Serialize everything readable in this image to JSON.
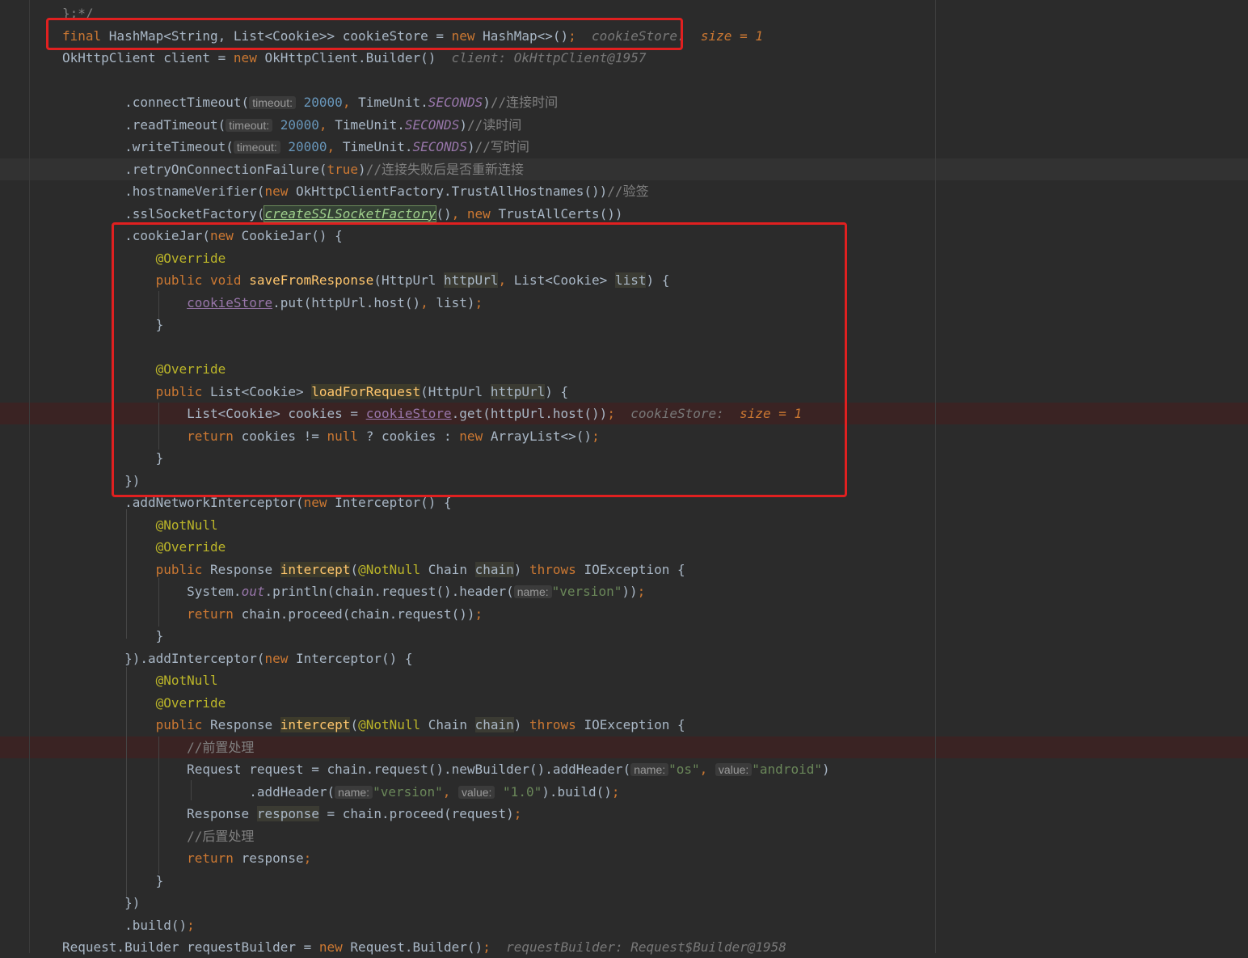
{
  "code_lines": [
    {
      "parts": [
        {
          "t": "};*/",
          "c": "com"
        }
      ]
    },
    {
      "parts": [
        {
          "t": "final ",
          "c": "kw"
        },
        {
          "t": "HashMap<String, List<Cookie>> cookieStore = "
        },
        {
          "t": "new ",
          "c": "kw"
        },
        {
          "t": "HashMap<>()"
        },
        {
          "t": ";",
          "c": "kw"
        },
        {
          "t": "  cookieStore:  ",
          "c": "dbg"
        },
        {
          "t": "size = 1",
          "c": "dbgv"
        }
      ]
    },
    {
      "parts": [
        {
          "t": "OkHttpClient client = "
        },
        {
          "t": "new ",
          "c": "kw"
        },
        {
          "t": "OkHttpClient.Builder()"
        },
        {
          "t": "  client: OkHttpClient@1957",
          "c": "dbg"
        }
      ]
    },
    {
      "parts": []
    },
    {
      "parts": [
        {
          "t": "        .connectTimeout("
        },
        {
          "t": "timeout:",
          "c": "ph"
        },
        {
          "t": " "
        },
        {
          "t": "20000",
          "c": "num"
        },
        {
          "t": ", ",
          "c": "kw"
        },
        {
          "t": "TimeUnit."
        },
        {
          "t": "SECONDS",
          "c": "const"
        },
        {
          "t": ")"
        },
        {
          "t": "//连接时间",
          "c": "com"
        }
      ]
    },
    {
      "parts": [
        {
          "t": "        .readTimeout("
        },
        {
          "t": "timeout:",
          "c": "ph"
        },
        {
          "t": " "
        },
        {
          "t": "20000",
          "c": "num"
        },
        {
          "t": ", ",
          "c": "kw"
        },
        {
          "t": "TimeUnit."
        },
        {
          "t": "SECONDS",
          "c": "const"
        },
        {
          "t": ")"
        },
        {
          "t": "//读时间",
          "c": "com"
        }
      ]
    },
    {
      "parts": [
        {
          "t": "        .writeTimeout("
        },
        {
          "t": "timeout:",
          "c": "ph"
        },
        {
          "t": " "
        },
        {
          "t": "20000",
          "c": "num"
        },
        {
          "t": ", ",
          "c": "kw"
        },
        {
          "t": "TimeUnit."
        },
        {
          "t": "SECONDS",
          "c": "const"
        },
        {
          "t": ")"
        },
        {
          "t": "//写时间",
          "c": "com"
        }
      ]
    },
    {
      "parts": [
        {
          "t": "        .retryOnConnectionFailure("
        },
        {
          "t": "true",
          "c": "kw"
        },
        {
          "t": ")"
        },
        {
          "t": "//连接失败后是否重新连接",
          "c": "com"
        }
      ]
    },
    {
      "parts": [
        {
          "t": "        .hostnameVerifier("
        },
        {
          "t": "new ",
          "c": "kw"
        },
        {
          "t": "OkHttpClientFactory.TrustAllHostnames())"
        },
        {
          "t": "//验签",
          "c": "com"
        }
      ]
    },
    {
      "parts": [
        {
          "t": "        .sslSocketFactory("
        },
        {
          "t": "createSSLSocketFactory",
          "c": "err"
        },
        {
          "t": "()"
        },
        {
          "t": ", ",
          "c": "kw"
        },
        {
          "t": "new ",
          "c": "kw"
        },
        {
          "t": "TrustAllCerts())"
        }
      ]
    },
    {
      "parts": [
        {
          "t": "        .cookieJar("
        },
        {
          "t": "new ",
          "c": "kw"
        },
        {
          "t": "CookieJar() {"
        }
      ]
    },
    {
      "parts": [
        {
          "t": "            "
        },
        {
          "t": "@Override",
          "c": "ann"
        }
      ]
    },
    {
      "parts": [
        {
          "t": "            "
        },
        {
          "t": "public void ",
          "c": "kw"
        },
        {
          "t": "saveFromResponse",
          "c": "fn"
        },
        {
          "t": "(HttpUrl "
        },
        {
          "t": "httpUrl",
          "c": "pm"
        },
        {
          "t": ", ",
          "c": "kw"
        },
        {
          "t": "List<Cookie> "
        },
        {
          "t": "list",
          "c": "pm"
        },
        {
          "t": ") {"
        }
      ]
    },
    {
      "parts": [
        {
          "t": "                "
        },
        {
          "t": "cookieStore",
          "c": "field"
        },
        {
          "t": ".put(httpUrl.host()"
        },
        {
          "t": ", ",
          "c": "kw"
        },
        {
          "t": "list)"
        },
        {
          "t": ";",
          "c": "kw"
        }
      ]
    },
    {
      "parts": [
        {
          "t": "            }"
        }
      ]
    },
    {
      "parts": []
    },
    {
      "parts": [
        {
          "t": "            "
        },
        {
          "t": "@Override",
          "c": "ann"
        }
      ]
    },
    {
      "parts": [
        {
          "t": "            "
        },
        {
          "t": "public ",
          "c": "kw"
        },
        {
          "t": "List<Cookie> "
        },
        {
          "t": "loadForRequest",
          "c": "fn mhl"
        },
        {
          "t": "(HttpUrl "
        },
        {
          "t": "httpUrl",
          "c": "pm"
        },
        {
          "t": ") {"
        }
      ]
    },
    {
      "parts": [
        {
          "t": "                List<Cookie> cookies = "
        },
        {
          "t": "cookieStore",
          "c": "field"
        },
        {
          "t": ".get(httpUrl.host())"
        },
        {
          "t": ";",
          "c": "kw"
        },
        {
          "t": "  cookieStore:  ",
          "c": "dbg"
        },
        {
          "t": "size = 1",
          "c": "dbgv"
        }
      ]
    },
    {
      "parts": [
        {
          "t": "                "
        },
        {
          "t": "return ",
          "c": "kw"
        },
        {
          "t": "cookies != "
        },
        {
          "t": "null ",
          "c": "kw"
        },
        {
          "t": "? cookies : "
        },
        {
          "t": "new ",
          "c": "kw"
        },
        {
          "t": "ArrayList<>()"
        },
        {
          "t": ";",
          "c": "kw"
        }
      ]
    },
    {
      "parts": [
        {
          "t": "            }"
        }
      ]
    },
    {
      "parts": [
        {
          "t": "        })"
        }
      ]
    },
    {
      "parts": [
        {
          "t": "        .addNetworkInterceptor("
        },
        {
          "t": "new ",
          "c": "kw"
        },
        {
          "t": "Interceptor() {"
        }
      ]
    },
    {
      "parts": [
        {
          "t": "            "
        },
        {
          "t": "@NotNull",
          "c": "ann"
        }
      ]
    },
    {
      "parts": [
        {
          "t": "            "
        },
        {
          "t": "@Override",
          "c": "ann"
        }
      ]
    },
    {
      "parts": [
        {
          "t": "            "
        },
        {
          "t": "public ",
          "c": "kw"
        },
        {
          "t": "Response "
        },
        {
          "t": "intercept",
          "c": "fn mhl"
        },
        {
          "t": "("
        },
        {
          "t": "@NotNull ",
          "c": "ann"
        },
        {
          "t": "Chain "
        },
        {
          "t": "chain",
          "c": "pm"
        },
        {
          "t": ") "
        },
        {
          "t": "throws ",
          "c": "kw"
        },
        {
          "t": "IOException {"
        }
      ]
    },
    {
      "parts": [
        {
          "t": "                System."
        },
        {
          "t": "out",
          "c": "const"
        },
        {
          "t": ".println(chain.request().header("
        },
        {
          "t": "name:",
          "c": "ph"
        },
        {
          "t": "\"version\"",
          "c": "str"
        },
        {
          "t": "))"
        },
        {
          "t": ";",
          "c": "kw"
        }
      ]
    },
    {
      "parts": [
        {
          "t": "                "
        },
        {
          "t": "return ",
          "c": "kw"
        },
        {
          "t": "chain.proceed(chain.request())"
        },
        {
          "t": ";",
          "c": "kw"
        }
      ]
    },
    {
      "parts": [
        {
          "t": "            }"
        }
      ]
    },
    {
      "parts": [
        {
          "t": "        }).addInterceptor("
        },
        {
          "t": "new ",
          "c": "kw"
        },
        {
          "t": "Interceptor() {"
        }
      ]
    },
    {
      "parts": [
        {
          "t": "            "
        },
        {
          "t": "@NotNull",
          "c": "ann"
        }
      ]
    },
    {
      "parts": [
        {
          "t": "            "
        },
        {
          "t": "@Override",
          "c": "ann"
        }
      ]
    },
    {
      "parts": [
        {
          "t": "            "
        },
        {
          "t": "public ",
          "c": "kw"
        },
        {
          "t": "Response "
        },
        {
          "t": "intercept",
          "c": "fn mhl"
        },
        {
          "t": "("
        },
        {
          "t": "@NotNull ",
          "c": "ann"
        },
        {
          "t": "Chain "
        },
        {
          "t": "chain",
          "c": "pm"
        },
        {
          "t": ") "
        },
        {
          "t": "throws ",
          "c": "kw"
        },
        {
          "t": "IOException {"
        }
      ]
    },
    {
      "parts": [
        {
          "t": "                "
        },
        {
          "t": "//前置处理",
          "c": "com"
        }
      ]
    },
    {
      "parts": [
        {
          "t": "                Request request = chain.request().newBuilder().addHeader("
        },
        {
          "t": "name:",
          "c": "ph"
        },
        {
          "t": "\"os\"",
          "c": "str"
        },
        {
          "t": ", ",
          "c": "kw"
        },
        {
          "t": "value:",
          "c": "ph"
        },
        {
          "t": "\"android\"",
          "c": "str"
        },
        {
          "t": ")"
        }
      ]
    },
    {
      "parts": [
        {
          "t": "                        .addHeader("
        },
        {
          "t": "name:",
          "c": "ph"
        },
        {
          "t": "\"version\"",
          "c": "str"
        },
        {
          "t": ", ",
          "c": "kw"
        },
        {
          "t": "value:",
          "c": "ph"
        },
        {
          "t": " "
        },
        {
          "t": "\"1.0\"",
          "c": "str"
        },
        {
          "t": ").build()"
        },
        {
          "t": ";",
          "c": "kw"
        }
      ]
    },
    {
      "parts": [
        {
          "t": "                Response "
        },
        {
          "t": "response",
          "c": "pm"
        },
        {
          "t": " = chain.proceed(request)"
        },
        {
          "t": ";",
          "c": "kw"
        }
      ]
    },
    {
      "parts": [
        {
          "t": "                "
        },
        {
          "t": "//后置处理",
          "c": "com"
        }
      ]
    },
    {
      "parts": [
        {
          "t": "                "
        },
        {
          "t": "return ",
          "c": "kw"
        },
        {
          "t": "response"
        },
        {
          "t": ";",
          "c": "kw"
        }
      ]
    },
    {
      "parts": [
        {
          "t": "            }"
        }
      ]
    },
    {
      "parts": [
        {
          "t": "        })"
        }
      ]
    },
    {
      "parts": [
        {
          "t": "        .build()"
        },
        {
          "t": ";",
          "c": "kw"
        }
      ]
    },
    {
      "parts": [
        {
          "t": "Request.Builder requestBuilder = "
        },
        {
          "t": "new ",
          "c": "kw"
        },
        {
          "t": "Request.Builder()"
        },
        {
          "t": ";",
          "c": "kw"
        },
        {
          "t": "  requestBuilder: Request$Builder@1958",
          "c": "dbg"
        }
      ]
    }
  ]
}
